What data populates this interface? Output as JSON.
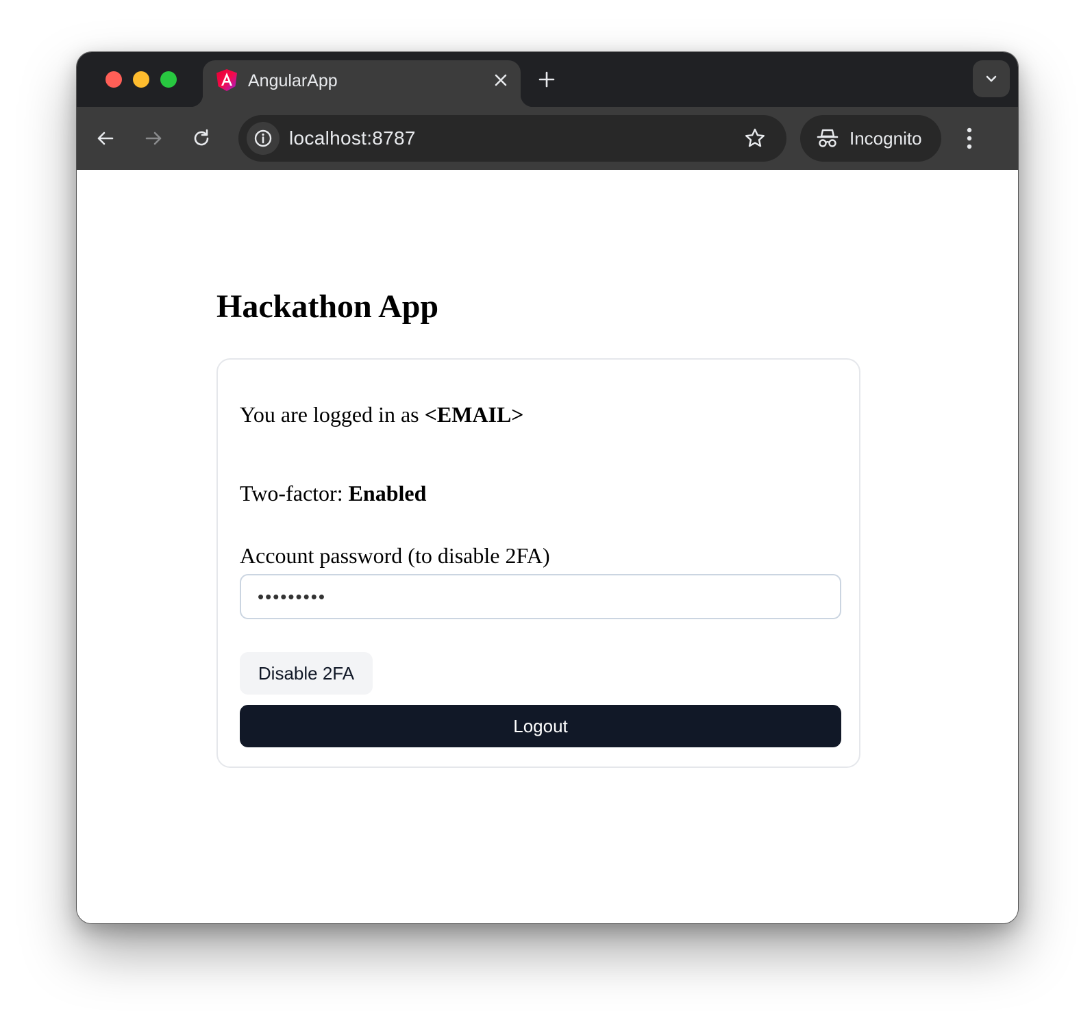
{
  "browser": {
    "tab": {
      "title": "AngularApp",
      "favicon": "angular-logo-icon"
    },
    "address_bar": {
      "url": "localhost:8787"
    },
    "profile": {
      "label": "Incognito"
    },
    "colors": {
      "titlebar": "#202124",
      "toolbar": "#3c3c3c",
      "omnibox": "#282828"
    }
  },
  "page": {
    "title": "Hackathon App",
    "logged_in_prefix": "You are logged in as ",
    "email": "<EMAIL>",
    "twofactor_prefix": "Two-factor: ",
    "twofactor_status": "Enabled",
    "password_label": "Account password (to disable 2FA)",
    "password_value": "xxxxxxxxx",
    "disable_button_label": "Disable 2FA",
    "logout_button_label": "Logout",
    "colors": {
      "logout_button": "#111827",
      "disable_button": "#f3f4f6",
      "card_border": "#e5e7eb"
    }
  }
}
